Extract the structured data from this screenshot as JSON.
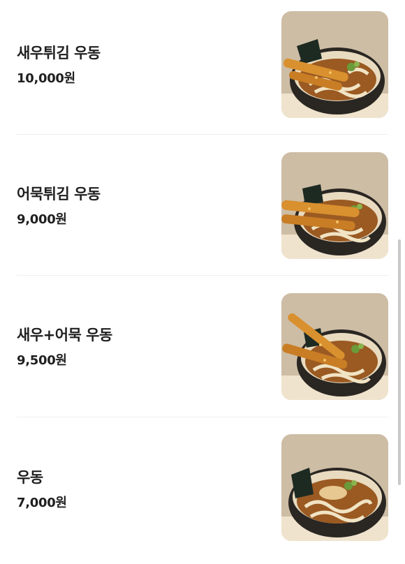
{
  "menu": {
    "items": [
      {
        "name": "새우튀김 우동",
        "price": "10,000원",
        "image_icon": "shrimp-tempura-udon-photo"
      },
      {
        "name": "어묵튀김 우동",
        "price": "9,000원",
        "image_icon": "fishcake-tempura-udon-photo"
      },
      {
        "name": "새우+어묵 우동",
        "price": "9,500원",
        "image_icon": "shrimp-fishcake-udon-photo"
      },
      {
        "name": "우동",
        "price": "7,000원",
        "image_icon": "plain-udon-photo"
      }
    ]
  },
  "colors": {
    "text": "#1f1f1f",
    "divider": "#efefef",
    "scrollbar": "#c9c9c9",
    "photo_wall": "#cdbda5",
    "bowl": "#2a2622",
    "broth": "#9a5a22",
    "tempura": "#d9902e"
  }
}
